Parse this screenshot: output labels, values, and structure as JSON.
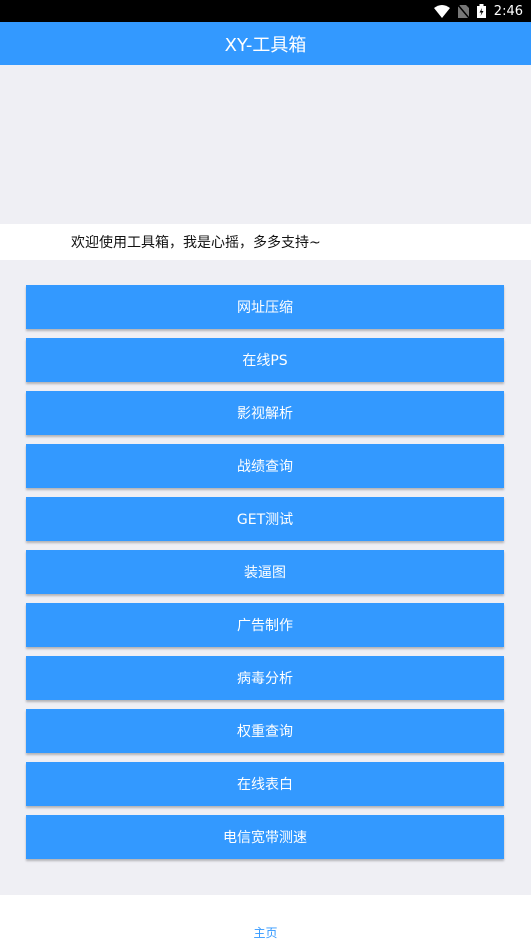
{
  "status_bar": {
    "time": "2:46",
    "icons": [
      "wifi-icon",
      "no-sim-icon",
      "battery-charging-icon"
    ]
  },
  "app_bar": {
    "title": "XY-工具箱"
  },
  "welcome_text": "欢迎使用工具箱，我是心摇，多多支持~",
  "tools": [
    {
      "label": "网址压缩"
    },
    {
      "label": "在线PS"
    },
    {
      "label": "影视解析"
    },
    {
      "label": "战绩查询"
    },
    {
      "label": "GET测试"
    },
    {
      "label": "装逼图"
    },
    {
      "label": "广告制作"
    },
    {
      "label": "病毒分析"
    },
    {
      "label": "权重查询"
    },
    {
      "label": "在线表白"
    },
    {
      "label": "电信宽带测速"
    }
  ],
  "bottom_nav": {
    "home_label": "主页"
  },
  "colors": {
    "primary": "#3399ff",
    "background": "#efeff4"
  }
}
